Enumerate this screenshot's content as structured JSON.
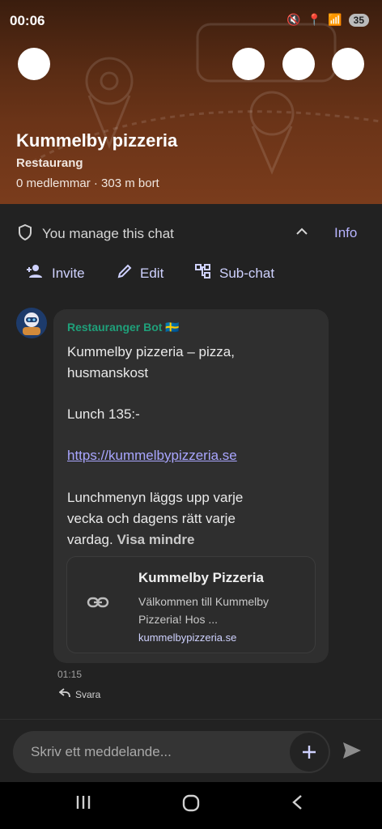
{
  "status": {
    "time": "00:06",
    "battery": "35"
  },
  "header": {
    "title": "Kummelby pizzeria",
    "category": "Restaurang",
    "meta": "0 medlemmar · 303 m bort"
  },
  "manage": {
    "text": "You manage this chat",
    "info_label": "Info"
  },
  "actions": {
    "invite": "Invite",
    "edit": "Edit",
    "subchat": "Sub-chat"
  },
  "message": {
    "sender": "Restauranger Bot 🇸🇪",
    "line1": "Kummelby pizzeria – pizza,",
    "line2": "husmanskost",
    "line3": "Lunch 135:-",
    "link": "https://kummelbypizzeria.se",
    "line4": "Lunchmenyn läggs upp varje",
    "line5": "vecka och dagens rätt varje",
    "line6": "vardag.",
    "show_less": "Visa mindre",
    "time": "01:15",
    "reply_label": "Svara"
  },
  "preview": {
    "title": "Kummelby Pizzeria",
    "desc": "Välkommen till Kummelby Pizzeria! Hos ...",
    "url": "kummelbypizzeria.se"
  },
  "composer": {
    "placeholder": "Skriv ett meddelande..."
  },
  "colors": {
    "accent": "#b7b4ff",
    "sender": "#1fa07a",
    "bubble": "#2f2f2f"
  }
}
